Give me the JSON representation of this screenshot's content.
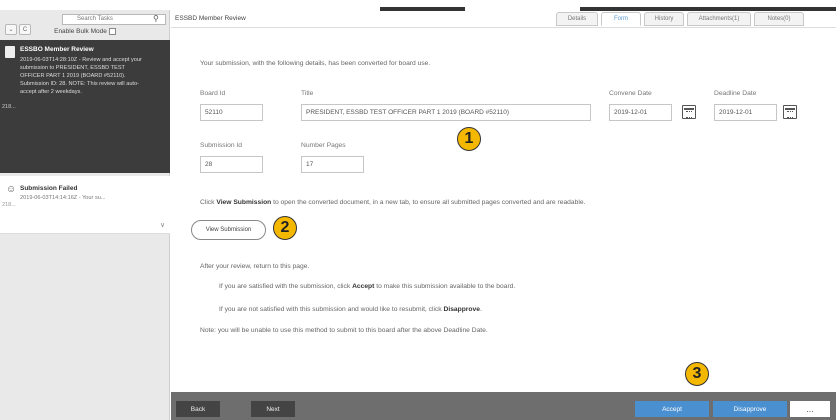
{
  "sidebar": {
    "search_placeholder": "Search Tasks",
    "bulk_mode_label": "Enable Bulk Mode",
    "items": [
      {
        "title": "ESSBO Member Review",
        "description": "2019-06-03T14:28:10Z - Review and accept your submission to PRESIDENT, ESSBD TEST OFFICER PART 1 2019 (BOARD #52110). Submission ID: 28. NOTE: This review will auto-accept after 2 weekdays.",
        "number": "218..."
      },
      {
        "title": "Submission Failed",
        "description": "2019-06-03T14:14:16Z - Your su...",
        "number": "218..."
      }
    ]
  },
  "header": {
    "title": "ESSBD Member Review",
    "tabs": [
      "Details",
      "Form",
      "History",
      "Attachments(1)",
      "Notes(0)"
    ],
    "active_tab": "Form"
  },
  "form": {
    "intro": "Your submission, with the following details, has been converted for board use.",
    "board_id_label": "Board Id",
    "board_id": "52110",
    "title_label": "Title",
    "title_value": "PRESIDENT, ESSBD TEST OFFICER PART 1 2019 (BOARD #52110)",
    "convene_label": "Convene Date",
    "convene_date": "2019-12-01",
    "deadline_label": "Deadline Date",
    "deadline_date": "2019-12-01",
    "submission_id_label": "Submission Id",
    "submission_id": "28",
    "pages_label": "Number Pages",
    "pages": "17",
    "instr_pre": "Click ",
    "instr_bold": "View Submission",
    "instr_post": " to open the converted document, in a new tab, to ensure all submitted pages converted and are readable.",
    "view_button": "View Submission",
    "after_review": "After your review, return to this page.",
    "accept_pre": "If you are satisfied with the submission, click ",
    "accept_bold": "Accept",
    "accept_post": " to make this submission available to the board.",
    "disapprove_pre": "If you are not satisfied with this submission and would like to resubmit, click ",
    "disapprove_bold": "Disapprove",
    "disapprove_post": ".",
    "note": "Note: you will be unable to use this method to submit to this board after the above Deadline Date."
  },
  "badges": [
    "1",
    "2",
    "3"
  ],
  "footer": {
    "back": "Back",
    "next": "Next",
    "accept": "Accept",
    "disapprove": "Disapprove",
    "more": "..."
  },
  "colors": {
    "accent": "#4a8fd0",
    "badge": "#f5b800",
    "sidebar_selected": "#3c3c3c"
  }
}
